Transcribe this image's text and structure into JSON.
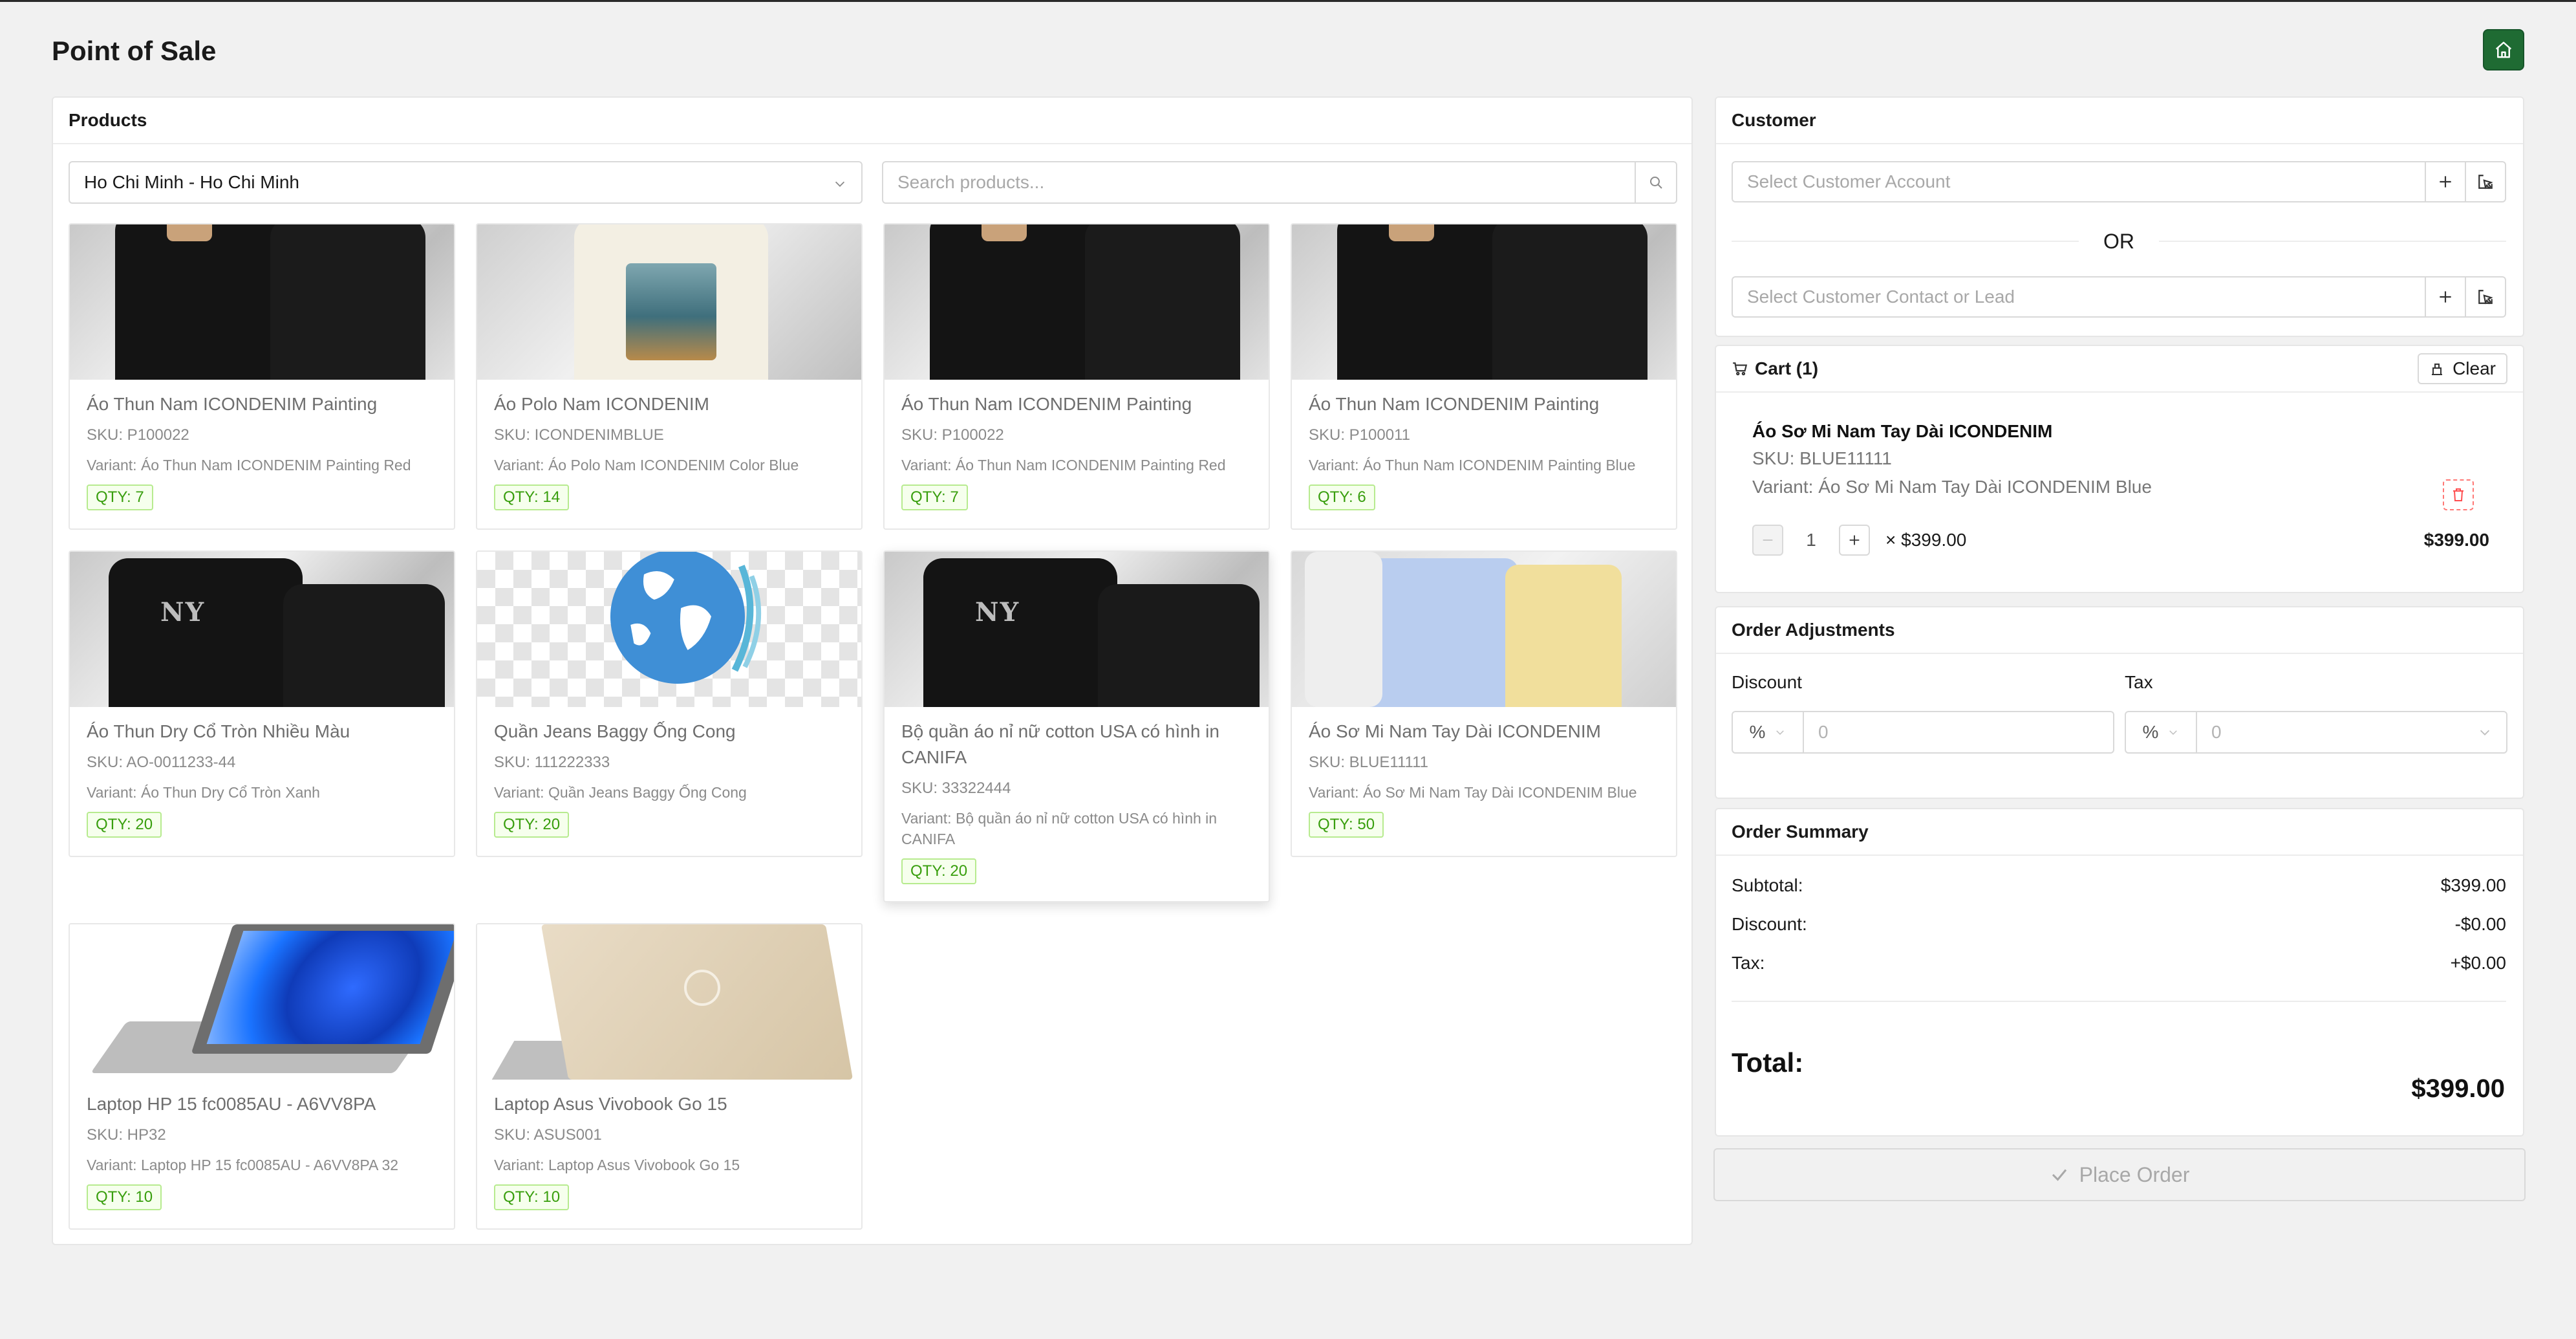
{
  "page": {
    "title": "Point of Sale"
  },
  "products": {
    "heading": "Products",
    "location_select": "Ho Chi Minh - Ho Chi Minh",
    "search_placeholder": "Search products...",
    "items": [
      {
        "name": "Áo Thun Nam ICONDENIM Painting",
        "sku": "SKU: P100022",
        "variant": "Variant: Áo Thun Nam ICONDENIM Painting Red",
        "qty": "QTY: 7",
        "image": "black-polo-shirts"
      },
      {
        "name": "Áo Polo Nam ICONDENIM",
        "sku": "SKU: ICONDENIMBLUE",
        "variant": "Variant: Áo Polo Nam ICONDENIM Color Blue",
        "qty": "QTY: 14",
        "image": "cream-painting-tee"
      },
      {
        "name": "Áo Thun Nam ICONDENIM Painting",
        "sku": "SKU: P100022",
        "variant": "Variant: Áo Thun Nam ICONDENIM Painting Red",
        "qty": "QTY: 7",
        "image": "black-polo-shirts"
      },
      {
        "name": "Áo Thun Nam ICONDENIM Painting",
        "sku": "SKU: P100011",
        "variant": "Variant: Áo Thun Nam ICONDENIM Painting Blue",
        "qty": "QTY: 6",
        "image": "black-polo-shirts"
      },
      {
        "name": "Áo Thun Dry Cổ Tròn Nhiều Màu",
        "sku": "SKU: AO-0011233-44",
        "variant": "Variant: Áo Thun Dry Cổ Tròn Xanh",
        "qty": "QTY: 20",
        "image": "new-york-sweat-set"
      },
      {
        "name": "Quần Jeans Baggy Ống Cong",
        "sku": "SKU: 111222333",
        "variant": "Variant: Quần Jeans Baggy Ống Cong",
        "qty": "QTY: 20",
        "image": "globe-placeholder"
      },
      {
        "name": "Bộ quần áo nỉ nữ cotton USA có hình in CANIFA",
        "sku": "SKU: 33322444",
        "variant": "Variant: Bộ quần áo nỉ nữ cotton USA có hình in CANIFA",
        "qty": "QTY: 20",
        "image": "new-york-sweat-set"
      },
      {
        "name": "Áo Sơ Mi Nam Tay Dài ICONDENIM",
        "sku": "SKU: BLUE11111",
        "variant": "Variant: Áo Sơ Mi Nam Tay Dài ICONDENIM Blue",
        "qty": "QTY: 50",
        "image": "folded-dress-shirts"
      },
      {
        "name": "Laptop HP 15 fc0085AU - A6VV8PA",
        "sku": "SKU: HP32",
        "variant": "Variant: Laptop HP 15 fc0085AU - A6VV8PA 32",
        "qty": "QTY: 10",
        "image": "hp-laptop-open"
      },
      {
        "name": "Laptop Asus Vivobook Go 15",
        "sku": "SKU: ASUS001",
        "variant": "Variant: Laptop Asus Vivobook Go 15",
        "qty": "QTY: 10",
        "image": "gold-laptop-closed"
      }
    ]
  },
  "customer": {
    "heading": "Customer",
    "account_placeholder": "Select Customer Account",
    "or_label": "OR",
    "contact_placeholder": "Select Customer Contact or Lead"
  },
  "cart": {
    "heading": "Cart (1)",
    "clear_label": "Clear",
    "item": {
      "name": "Áo Sơ Mi Nam Tay Dài ICONDENIM",
      "sku": "SKU: BLUE11111",
      "variant": "Variant: Áo Sơ Mi Nam Tay Dài ICONDENIM Blue",
      "quantity": "1",
      "unit_price": "× $399.00",
      "line_total": "$399.00"
    }
  },
  "adjustments": {
    "heading": "Order Adjustments",
    "discount_label": "Discount",
    "discount_type": "%",
    "discount_value": "0",
    "tax_label": "Tax",
    "tax_type": "%",
    "tax_value": "0"
  },
  "summary": {
    "heading": "Order Summary",
    "subtotal_label": "Subtotal:",
    "subtotal_value": "$399.00",
    "discount_label": "Discount:",
    "discount_value": "-$0.00",
    "tax_label": "Tax:",
    "tax_value": "+$0.00",
    "total_label": "Total:",
    "total_value": "$399.00"
  },
  "place_order_label": "Place Order",
  "colors": {
    "brand_green": "#1f6b33",
    "qty_green": "#389e0d",
    "danger": "#ff7875"
  }
}
